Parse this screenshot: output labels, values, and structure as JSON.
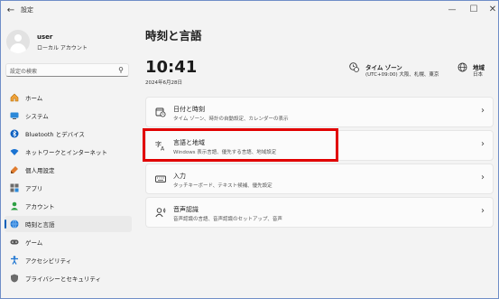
{
  "window": {
    "title": "設定",
    "back_icon": "back-arrow-icon",
    "controls": [
      "minimize-icon",
      "maximize-icon",
      "close-icon"
    ]
  },
  "user": {
    "name": "user",
    "account_type": "ローカル アカウント"
  },
  "search": {
    "placeholder": "設定の検索"
  },
  "sidebar": {
    "items": [
      {
        "label": "ホーム",
        "icon": "home-icon"
      },
      {
        "label": "システム",
        "icon": "system-icon"
      },
      {
        "label": "Bluetooth とデバイス",
        "icon": "bluetooth-icon"
      },
      {
        "label": "ネットワークとインターネット",
        "icon": "network-icon"
      },
      {
        "label": "個人用設定",
        "icon": "personalization-icon"
      },
      {
        "label": "アプリ",
        "icon": "apps-icon"
      },
      {
        "label": "アカウント",
        "icon": "account-icon"
      },
      {
        "label": "時刻と言語",
        "icon": "time-language-icon",
        "selected": true
      },
      {
        "label": "ゲーム",
        "icon": "gaming-icon"
      },
      {
        "label": "アクセシビリティ",
        "icon": "accessibility-icon"
      },
      {
        "label": "プライバシーとセキュリティ",
        "icon": "privacy-icon"
      }
    ]
  },
  "main": {
    "title": "時刻と言語",
    "time": "10:41",
    "date": "2024年6月28日",
    "timezone": {
      "label": "タイム ゾーン",
      "value": "(UTC+09:00) 大阪、札幌、東京"
    },
    "region": {
      "label": "地域",
      "value": "日本"
    },
    "cards": [
      {
        "title": "日付と時刻",
        "desc": "タイム ゾーン、時計の自動設定、カレンダーの表示",
        "icon": "calendar-clock-icon"
      },
      {
        "title": "言語と地域",
        "desc": "Windows 表示言語、優先する言語、地域設定",
        "icon": "language-icon"
      },
      {
        "title": "入力",
        "desc": "タッチキーボード、テキスト候補、優先設定",
        "icon": "keyboard-icon"
      },
      {
        "title": "音声認識",
        "desc": "音声認識の言語、音声認識のセットアップ、音声",
        "icon": "speech-icon"
      }
    ]
  },
  "colors": {
    "accent": "#005fb8",
    "highlight_box": "#e10000"
  }
}
